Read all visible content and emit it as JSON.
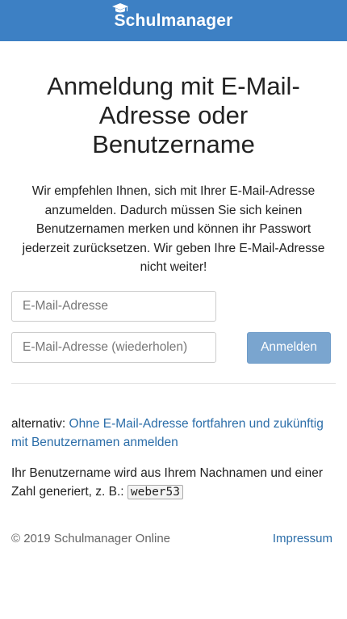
{
  "header": {
    "logo_text": "Schulmanager",
    "bar_color": "#3d80c4",
    "cap_icon": "graduation-cap-icon"
  },
  "main": {
    "title": "Anmeldung mit E-Mail-Adresse oder Benutzername",
    "intro": "Wir empfehlen Ihnen, sich mit Ihrer E-Mail-Adresse anzumelden. Dadurch müssen Sie sich keinen Benutzernamen merken und können ihr Passwort jederzeit zurücksetzen. Wir geben Ihre E-Mail-Adresse nicht weiter!",
    "email_placeholder": "E-Mail-Adresse",
    "email_repeat_placeholder": "E-Mail-Adresse (wiederholen)",
    "login_button": "Anmelden",
    "alternative_prefix": "alternativ: ",
    "alternative_link": "Ohne E-Mail-Adresse fortfahren und zukünftig mit Benutzernamen anmelden",
    "username_note": "Ihr Benutzername wird aus Ihrem Nachnamen und einer Zahl generiert, z. B.: ",
    "username_example": "weber53",
    "link_color": "#2c6ea9",
    "button_color": "#7aa5cf"
  },
  "footer": {
    "copyright": "© 2019 Schulmanager Online",
    "impressum": "Impressum"
  }
}
